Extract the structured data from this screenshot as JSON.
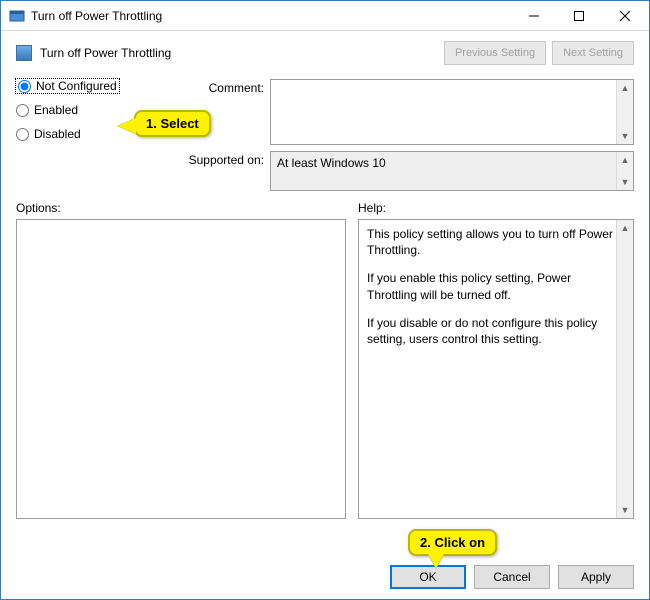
{
  "window": {
    "title": "Turn off Power Throttling"
  },
  "header": {
    "heading": "Turn off Power Throttling",
    "prev": "Previous Setting",
    "next": "Next Setting"
  },
  "radios": {
    "not_configured": "Not Configured",
    "enabled": "Enabled",
    "disabled": "Disabled",
    "selected": "not_configured"
  },
  "fields": {
    "comment_label": "Comment:",
    "comment_value": "",
    "supported_label": "Supported on:",
    "supported_value": "At least Windows 10"
  },
  "lower": {
    "options_label": "Options:",
    "help_label": "Help:",
    "help_p1": "This policy setting allows you to turn off Power Throttling.",
    "help_p2": "If you enable this policy setting, Power Throttling will be turned off.",
    "help_p3": "If you disable or do not configure this policy setting, users control this setting."
  },
  "buttons": {
    "ok": "OK",
    "cancel": "Cancel",
    "apply": "Apply"
  },
  "annotations": {
    "step1": "1. Select",
    "step2": "2. Click on"
  }
}
